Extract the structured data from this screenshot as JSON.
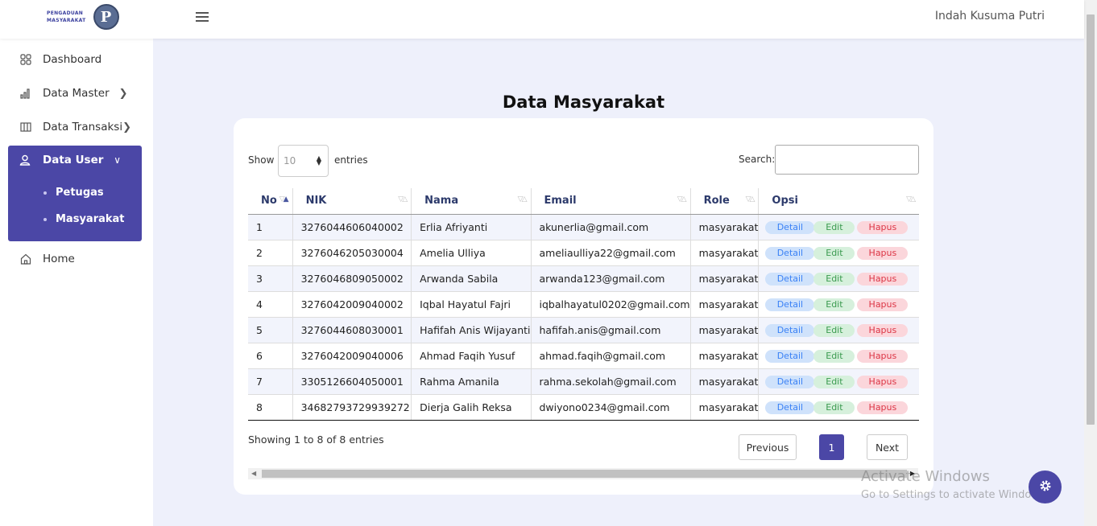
{
  "brand": {
    "line1": "PENGADUAN",
    "line2": "MASYARAKAT",
    "emblem": "P"
  },
  "header": {
    "user_name": "Indah Kusuma Putri"
  },
  "sidebar": {
    "items": [
      {
        "label": "Dashboard",
        "icon": "grid-icon"
      },
      {
        "label": "Data Master",
        "icon": "bar-chart-icon"
      },
      {
        "label": "Data Transaksi",
        "icon": "columns-icon"
      },
      {
        "label": "Data User",
        "icon": "user-icon"
      },
      {
        "label": "Home",
        "icon": "home-icon"
      }
    ],
    "submenu": [
      {
        "label": "Petugas"
      },
      {
        "label": "Masyarakat"
      }
    ]
  },
  "main": {
    "title": "Data Masyarakat",
    "show_label": "Show",
    "entries_value": "10",
    "entries_label": "entries",
    "search_label": "Search:",
    "search_value": "",
    "columns": [
      "No",
      "NIK",
      "Nama",
      "Email",
      "Role",
      "Opsi"
    ],
    "rows": [
      [
        "1",
        "3276044606040002",
        "Erlia Afriyanti",
        "akunerlia@gmail.com",
        "masyarakat"
      ],
      [
        "2",
        "3276046205030004",
        "Amelia Ulliya",
        "ameliaulliya22@gmail.com",
        "masyarakat"
      ],
      [
        "3",
        "3276046809050002",
        "Arwanda Sabila",
        "arwanda123@gmail.com",
        "masyarakat"
      ],
      [
        "4",
        "3276042009040002",
        "Iqbal Hayatul Fajri",
        "iqbalhayatul0202@gmail.com",
        "masyarakat"
      ],
      [
        "5",
        "3276044608030001",
        "Hafifah Anis Wijayanti",
        "hafifah.anis@gmail.com",
        "masyarakat"
      ],
      [
        "6",
        "3276042009040006",
        "Ahmad Faqih Yusuf",
        "ahmad.faqih@gmail.com",
        "masyarakat"
      ],
      [
        "7",
        "3305126604050001",
        "Rahma Amanila",
        "rahma.sekolah@gmail.com",
        "masyarakat"
      ],
      [
        "8",
        "34682793729939272",
        "Dierja Galih Reksa",
        "dwiyono0234@gmail.com",
        "masyarakat"
      ]
    ],
    "actions": {
      "detail": "Detail",
      "edit": "Edit",
      "hapus": "Hapus"
    },
    "info": "Showing 1 to 8 of 8 entries",
    "pagination": {
      "previous": "Previous",
      "current": "1",
      "next": "Next"
    }
  },
  "watermark": {
    "line1": "Activate Windows",
    "line2": "Go to Settings to activate Windows."
  },
  "colors": {
    "primary": "#4b47a6",
    "detail": "#3b82f6",
    "edit": "#3a9a4f",
    "hapus": "#dc3545",
    "background": "#eef0fb"
  }
}
